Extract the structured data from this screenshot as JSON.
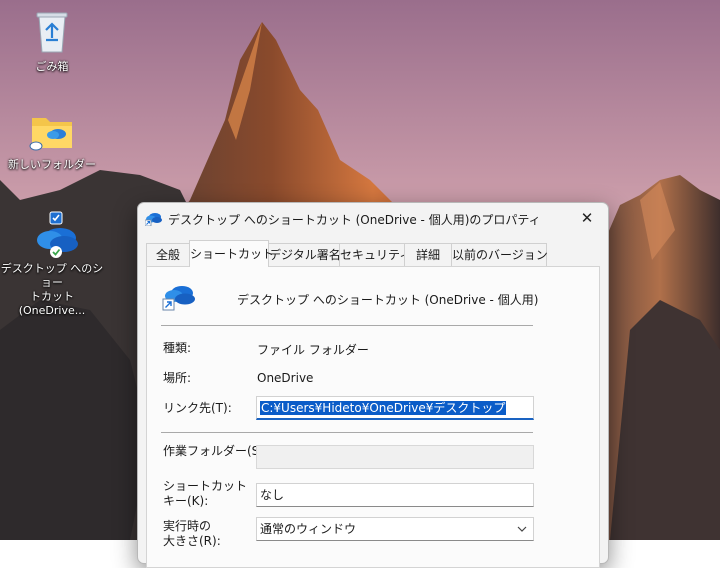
{
  "desktop": {
    "icons": [
      {
        "label": "ごみ箱",
        "icon": "recycle-bin-icon"
      },
      {
        "label": "新しいフォルダー",
        "icon": "folder-icon"
      },
      {
        "label": "デスクトップ へのショートカット (OneDrive...",
        "label_line1": "デスクトップ へのショー",
        "label_line2": "トカット (OneDrive...",
        "icon": "onedrive-shortcut-icon"
      }
    ]
  },
  "dialog": {
    "title": "デスクトップ へのショートカット (OneDrive - 個人用)のプロパティ",
    "close_glyph": "✕",
    "tabs": [
      {
        "label": "全般",
        "active": false
      },
      {
        "label": "ショートカット",
        "active": true
      },
      {
        "label": "デジタル署名",
        "active": false
      },
      {
        "label": "セキュリティ",
        "active": false
      },
      {
        "label": "詳細",
        "active": false
      },
      {
        "label": "以前のバージョン",
        "active": false
      }
    ],
    "shortcut": {
      "name": "デスクトップ へのショートカット (OneDrive - 個人用)",
      "type_label": "種類:",
      "type_value": "ファイル フォルダー",
      "location_label": "場所:",
      "location_value": "OneDrive",
      "target_label": "リンク先(T):",
      "target_value": "C:¥Users¥Hideto¥OneDrive¥デスクトップ",
      "workdir_label": "作業フォルダー(S):",
      "workdir_value": "",
      "hotkey_label_line1": "ショートカット",
      "hotkey_label_line2": "キー(K):",
      "hotkey_value": "なし",
      "run_label_line1": "実行時の",
      "run_label_line2": "大きさ(R):",
      "run_value": "通常のウィンドウ"
    }
  }
}
